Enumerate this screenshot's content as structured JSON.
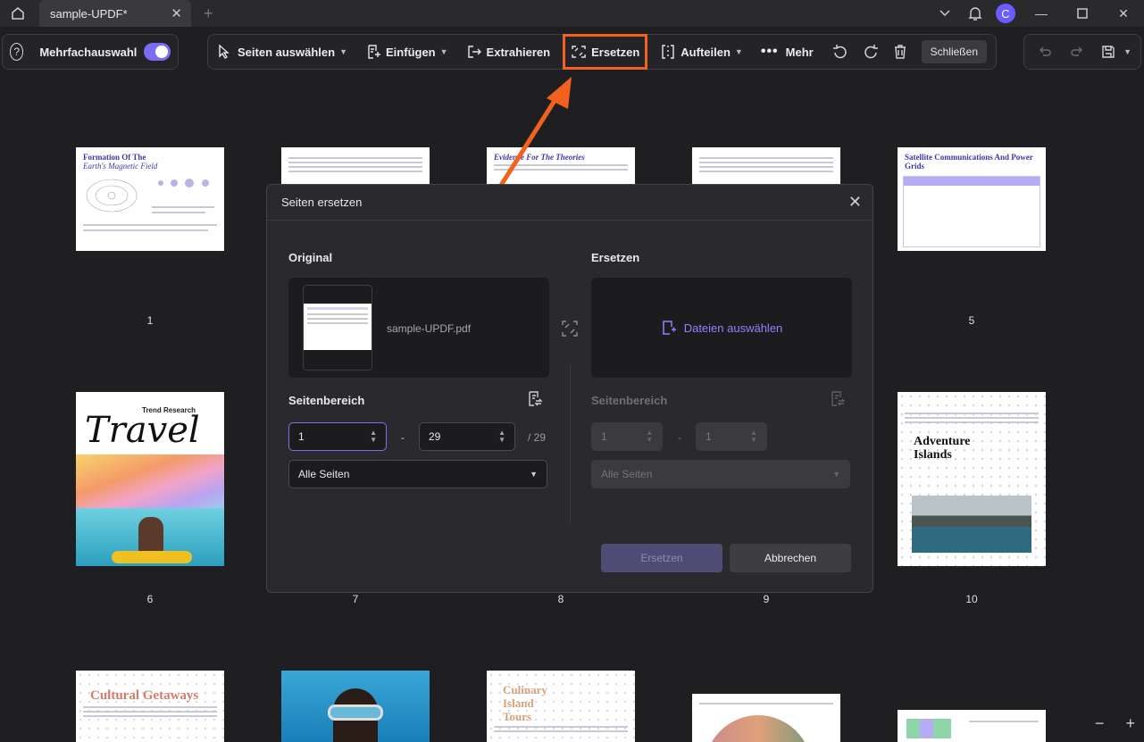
{
  "titlebar": {
    "tab_label": "sample-UPDF*",
    "avatar_letter": "C"
  },
  "toolbar": {
    "multi_select_label": "Mehrfachauswahl",
    "select_pages": "Seiten auswählen",
    "insert": "Einfügen",
    "extract": "Extrahieren",
    "replace": "Ersetzen",
    "split": "Aufteilen",
    "more": "Mehr",
    "close": "Schließen"
  },
  "pages": {
    "numbers": [
      "1",
      "5",
      "6",
      "7",
      "8",
      "9",
      "10"
    ],
    "thumb1_title": "Formation Of The",
    "thumb1_sub": "Earth's Magnetic Field",
    "thumb3_title": "Evidence For The Theories",
    "thumb5_title": "Satellite Communications And Power Grids",
    "thumb6_title": "Travel",
    "thumb6_sub": "Trend Research",
    "thumb10_title": "Adventure Islands",
    "bottom1_title": "Cultural Getaways",
    "bottom3_title": "Culinary Island Tours"
  },
  "dialog": {
    "title": "Seiten ersetzen",
    "original_label": "Original",
    "replace_label": "Ersetzen",
    "file_name": "sample-UPDF.pdf",
    "choose_files": "Dateien auswählen",
    "range_label": "Seitenbereich",
    "from_value": "1",
    "to_value": "29",
    "total": "/ 29",
    "dash": "-",
    "all_pages": "Alle Seiten",
    "repl_from": "1",
    "repl_to": "1",
    "replace_button": "Ersetzen",
    "cancel_button": "Abbrechen"
  },
  "colors": {
    "accent": "#7a6cf5",
    "highlight": "#f2621e",
    "background": "#1f1f22"
  }
}
